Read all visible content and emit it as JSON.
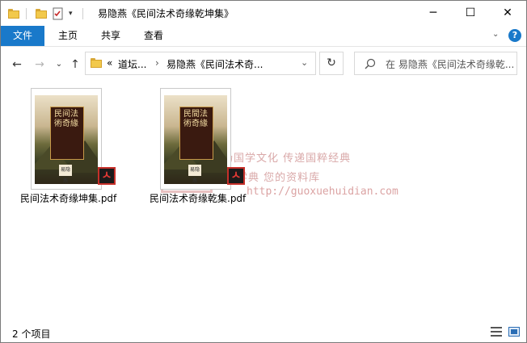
{
  "window": {
    "title": "易隐燕《民间法术奇缘乾坤集》"
  },
  "controls": {
    "minimize": "─",
    "maximize": "☐",
    "close": "✕"
  },
  "ribbon": {
    "tabs": [
      "文件",
      "主页",
      "共享",
      "查看"
    ],
    "help": "?"
  },
  "nav": {
    "back": "←",
    "forward": "→",
    "recent": "⌄",
    "up": "↑"
  },
  "address": {
    "prefix": "«",
    "crumbs": [
      "道坛...",
      "易隐燕《民间法术奇..."
    ],
    "separator": "›",
    "dropdown": "⌄",
    "refresh": "↻"
  },
  "search": {
    "placeholder": "在 易隐燕《民间法术奇缘乾..."
  },
  "files": [
    {
      "name": "民间法术奇缘坤集.pdf",
      "cover_title": "民间法術奇緣",
      "cover_author": "易隐燕"
    },
    {
      "name": "民间法术奇缘乾集.pdf",
      "cover_title": "民間法術奇緣",
      "cover_author": "易隐燕"
    }
  ],
  "watermark": {
    "line1": "弘扬国学文化  传递国粹经典",
    "line2": "国学典  您的资料库",
    "url": "http://guoxuehuidian.com",
    "logo": "国学典"
  },
  "status": {
    "count": "2 个项目"
  },
  "colors": {
    "file_tab": "#1979ca",
    "pdf_badge_border": "#c7302a",
    "help_icon": "#1979ca"
  }
}
